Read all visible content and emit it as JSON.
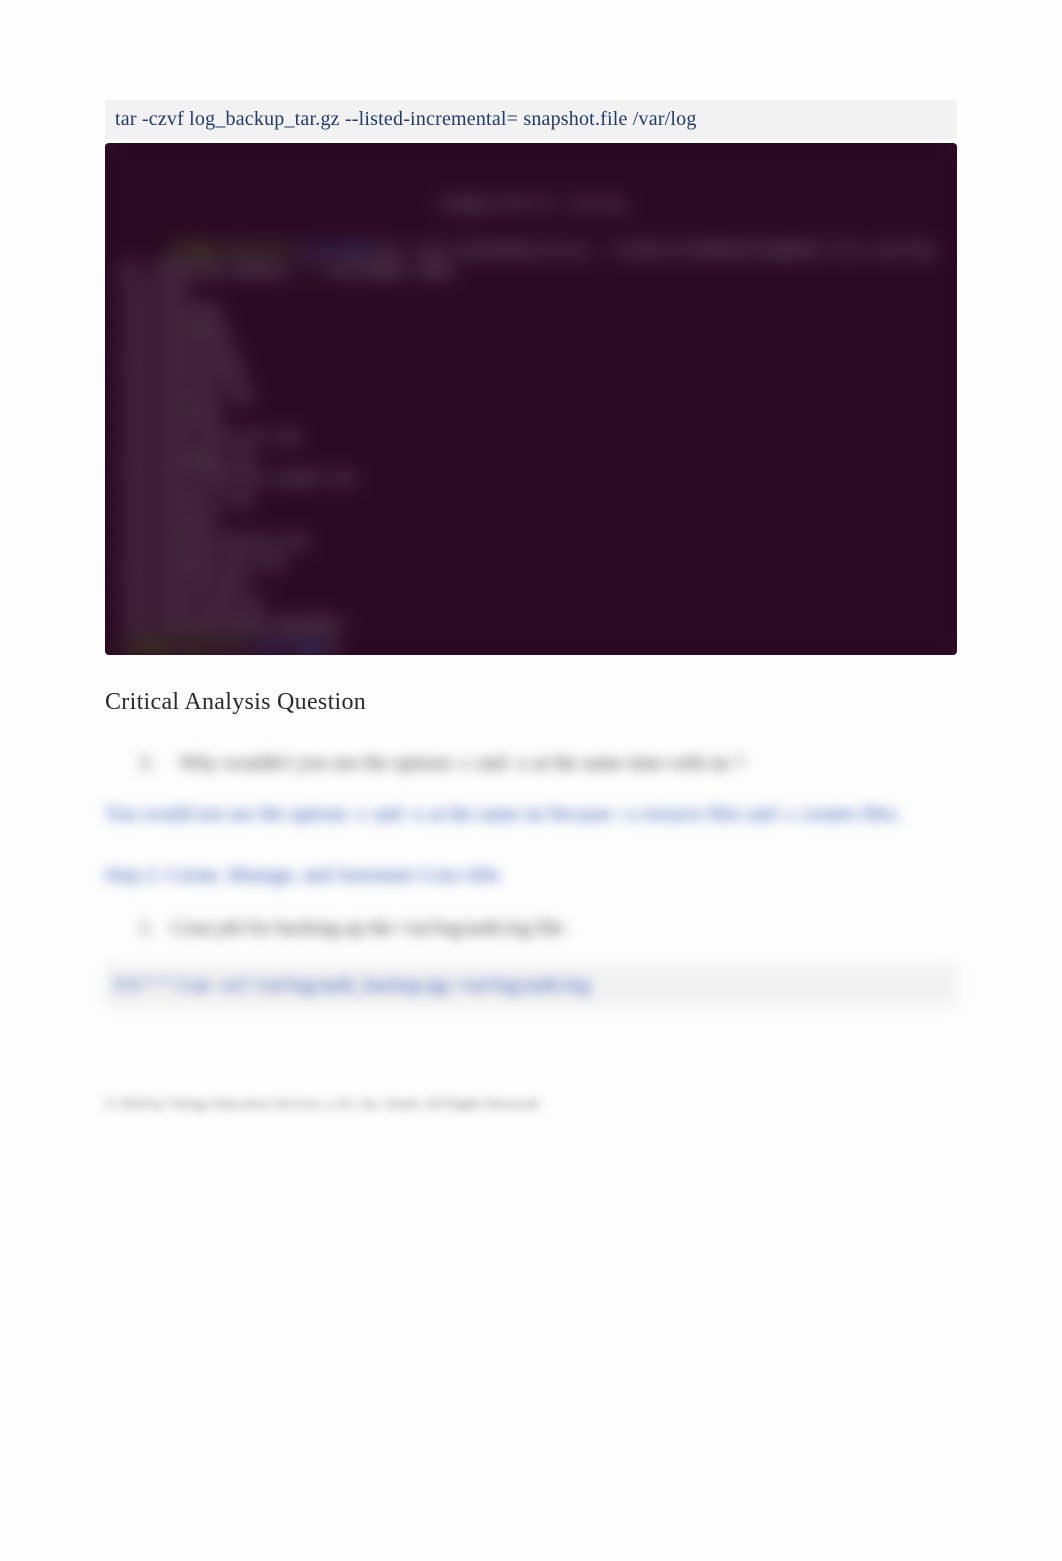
{
  "code_block_1": "tar -czvf log_backup_tar.gz --listed-incremental= snapshot.file /var/log",
  "terminal": {
    "title": "root@ip-10-0-0-5: /var/log",
    "line1_prompt": "root@ip-10-0-0-5",
    "line1_path": ":/var/log# ",
    "line1_cmd": "tar -czvf log_backup_tar.gz --listed-incremental=snapshot.file /var/log",
    "lines": "tar: Removing leading `/' from member names\n/var/log/\n/var/log/wtmp\n/var/log/dmesg\n/var/log/syslog\n/var/log/lastlog\n/var/log/auth.log\n/var/log/btmp\n/var/log/cloud-init.log\n/var/log/dpkg.log\n/var/log/cloud-init-output.log\n/var/log/kern.log\n/var/log/apt/\n/var/log/apt/history.log\n/var/log/apt/term.log\n/var/log/journal/\n/var/log/installer/\n/var/log/unattended-upgrades/",
    "line_end_prompt": "root@ip-10-0-0-5",
    "line_end_path": ":/var/log# ",
    "cursor": "▮"
  },
  "heading": "Critical Analysis Question",
  "question1_num": "3.",
  "question1_text": "Why wouldn't you use the options  -c and -x at the same time with  tar ?",
  "answer1": "You would not use the options -c and -x at the same tar because -x extracts files and -c creates files.",
  "step_title": "Step 2: Create, Manage, and Automate Cron Jobs",
  "question2_num": "1.",
  "question2_text": "Cron job for backing up the    /var/log/auth.log    file.",
  "code_block_2": "0 6 * * 3 tar -zcf /var/log/auth_backup.tgz /var/log/auth.log",
  "footer": "© 2020 by Trilogy Education Services, a 2U, Inc. brand. All Rights Reserved."
}
